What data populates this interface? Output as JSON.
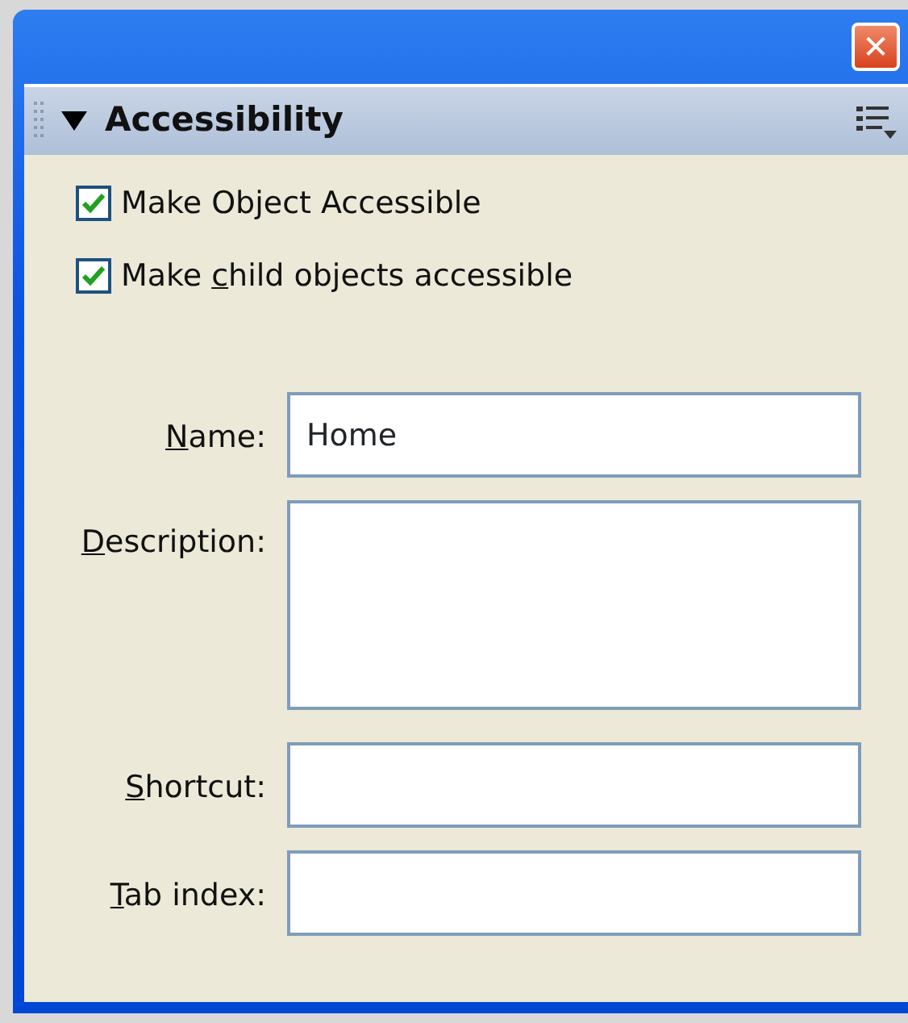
{
  "window": {
    "close_glyph": "✕"
  },
  "panel": {
    "title": "Accessibility",
    "expanded": true
  },
  "checkboxes": [
    {
      "label": {
        "pre": "Make Object Accessible"
      },
      "checked": true
    },
    {
      "label": {
        "pre": "Make ",
        "key": "c",
        "post": "hild objects accessible"
      },
      "checked": true
    }
  ],
  "fields": [
    {
      "kind": "line",
      "label": {
        "key": "N",
        "post": "ame:"
      },
      "value": "Home"
    },
    {
      "kind": "area",
      "label": {
        "key": "D",
        "post": "escription:"
      }
    },
    {
      "kind": "line",
      "label": {
        "key": "S",
        "post": "hortcut:"
      }
    },
    {
      "kind": "line",
      "label": {
        "key": "T",
        "post": "ab index:"
      }
    }
  ]
}
